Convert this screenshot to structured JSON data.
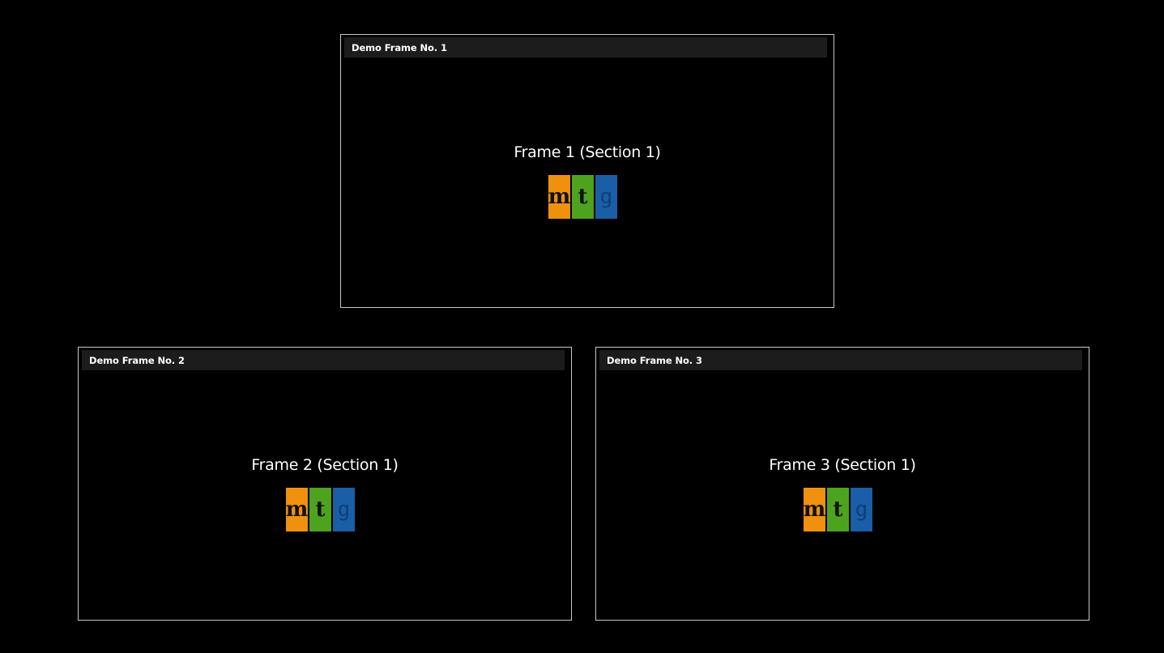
{
  "frames": [
    {
      "title": "Demo Frame No. 1",
      "heading": "Frame 1 (Section 1)",
      "logo": {
        "letters": [
          "m",
          "t",
          "g"
        ],
        "colors": [
          "#f0900f",
          "#4ea31e",
          "#1a5ea8"
        ]
      }
    },
    {
      "title": "Demo Frame No. 2",
      "heading": "Frame 2 (Section 1)",
      "logo": {
        "letters": [
          "m",
          "t",
          "g"
        ],
        "colors": [
          "#f0900f",
          "#4ea31e",
          "#1a5ea8"
        ]
      }
    },
    {
      "title": "Demo Frame No. 3",
      "heading": "Frame 3 (Section 1)",
      "logo": {
        "letters": [
          "m",
          "t",
          "g"
        ],
        "colors": [
          "#f0900f",
          "#4ea31e",
          "#1a5ea8"
        ]
      }
    }
  ]
}
